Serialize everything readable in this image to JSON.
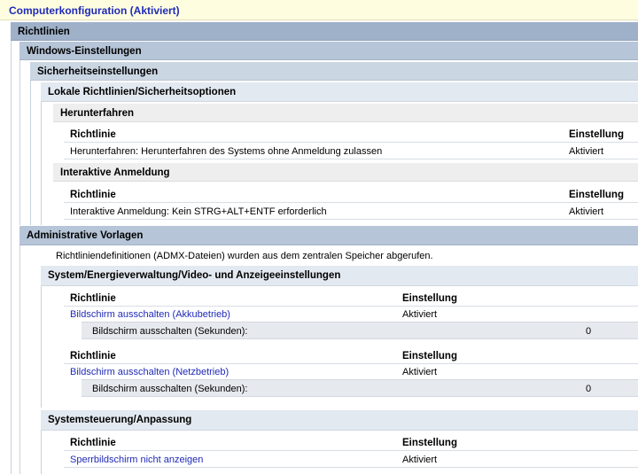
{
  "header": {
    "title": "Computerkonfiguration (Aktiviert)"
  },
  "sections": {
    "richtlinien": "Richtlinien",
    "windows": "Windows-Einstellungen",
    "sicherheit": "Sicherheitseinstellungen",
    "lokale": "Lokale Richtlinien/Sicherheitsoptionen",
    "herunterfahren": "Herunterfahren",
    "interaktiv": "Interaktive Anmeldung",
    "admin": "Administrative Vorlagen",
    "energie": "System/Energieverwaltung/Video- und Anzeigeeinstellungen",
    "systemsteuerung": "Systemsteuerung/Anpassung"
  },
  "columns": {
    "policy": "Richtlinie",
    "setting": "Einstellung"
  },
  "security_policies": [
    {
      "name": "Herunterfahren: Herunterfahren des Systems ohne Anmeldung zulassen",
      "setting": "Aktiviert"
    },
    {
      "name": "Interaktive Anmeldung: Kein STRG+ALT+ENTF erforderlich",
      "setting": "Aktiviert"
    }
  ],
  "admx_note": "Richtliniendefinitionen (ADMX-Dateien) wurden aus dem zentralen Speicher abgerufen.",
  "admin_policies": [
    {
      "name": "Bildschirm ausschalten (Akkubetrieb)",
      "setting": "Aktiviert",
      "option_label": "Bildschirm ausschalten (Sekunden):",
      "option_value": "0"
    },
    {
      "name": "Bildschirm ausschalten (Netzbetrieb)",
      "setting": "Aktiviert",
      "option_label": "Bildschirm ausschalten (Sekunden):",
      "option_value": "0"
    },
    {
      "name": "Sperrbildschirm nicht anzeigen",
      "setting": "Aktiviert"
    }
  ]
}
